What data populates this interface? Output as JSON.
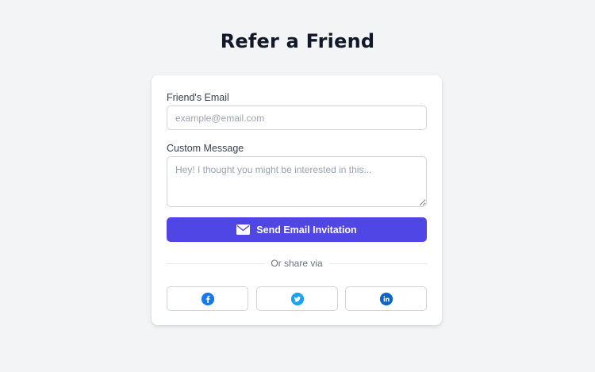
{
  "page": {
    "title": "Refer a Friend"
  },
  "form": {
    "email_label": "Friend's Email",
    "email_placeholder": "example@email.com",
    "email_value": "",
    "message_label": "Custom Message",
    "message_placeholder": "Hey! I thought you might be interested in this...",
    "message_value": "",
    "send_label": "Send Email Invitation",
    "send_icon": "envelope-icon"
  },
  "share": {
    "divider_text": "Or share via",
    "buttons": [
      {
        "network": "facebook",
        "icon": "facebook-icon",
        "color": "#1877f2"
      },
      {
        "network": "twitter",
        "icon": "twitter-icon",
        "color": "#1da1f2"
      },
      {
        "network": "linkedin",
        "icon": "linkedin-icon",
        "color": "#0a66c2"
      }
    ]
  },
  "colors": {
    "background": "#f3f4f6",
    "card": "#ffffff",
    "accent": "#4f46e5",
    "title": "#111827"
  }
}
